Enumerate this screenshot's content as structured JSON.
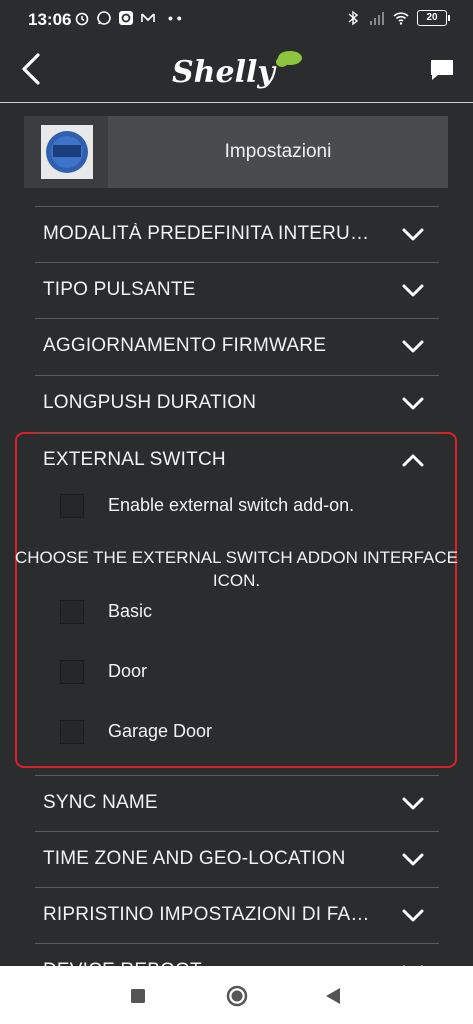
{
  "status_bar": {
    "time": "13:06",
    "battery": "20",
    "left_icons": [
      "alarm-icon",
      "whatsapp-icon",
      "q-app-icon",
      "mail-icon",
      "more-dots-icon"
    ],
    "right_icons": [
      "bluetooth-icon",
      "signal-icon",
      "wifi-icon",
      "battery-icon"
    ]
  },
  "header": {
    "logo_text": "Shelly"
  },
  "device": {
    "title": "Impostazioni"
  },
  "sections": [
    {
      "label": "MODALITÀ PREDEFINITA INTERUZZI…",
      "expanded": false
    },
    {
      "label": "TIPO PULSANTE",
      "expanded": false
    },
    {
      "label": "AGGIORNAMENTO FIRMWARE",
      "expanded": false
    },
    {
      "label": "LONGPUSH DURATION",
      "expanded": false
    },
    {
      "label": "EXTERNAL SWITCH",
      "expanded": true
    },
    {
      "label": "SYNC NAME",
      "expanded": false
    },
    {
      "label": "TIME ZONE AND GEO-LOCATION",
      "expanded": false
    },
    {
      "label": "RIPRISTINO IMPOSTAZIONI DI FABBR…",
      "expanded": false
    },
    {
      "label": "DEVICE REBOOT",
      "expanded": false
    }
  ],
  "external_switch": {
    "enable_label": "Enable external switch add-on.",
    "enable_checked": false,
    "choose_title": "CHOOSE THE EXTERNAL SWITCH ADDON INTERFACE ICON.",
    "icon_options": [
      {
        "label": "Basic",
        "checked": false
      },
      {
        "label": "Door",
        "checked": false
      },
      {
        "label": "Garage Door",
        "checked": false
      }
    ]
  },
  "colors": {
    "background": "#2b2c2e",
    "highlight": "#d8202a",
    "logo_leaf": "#8cc63f"
  }
}
